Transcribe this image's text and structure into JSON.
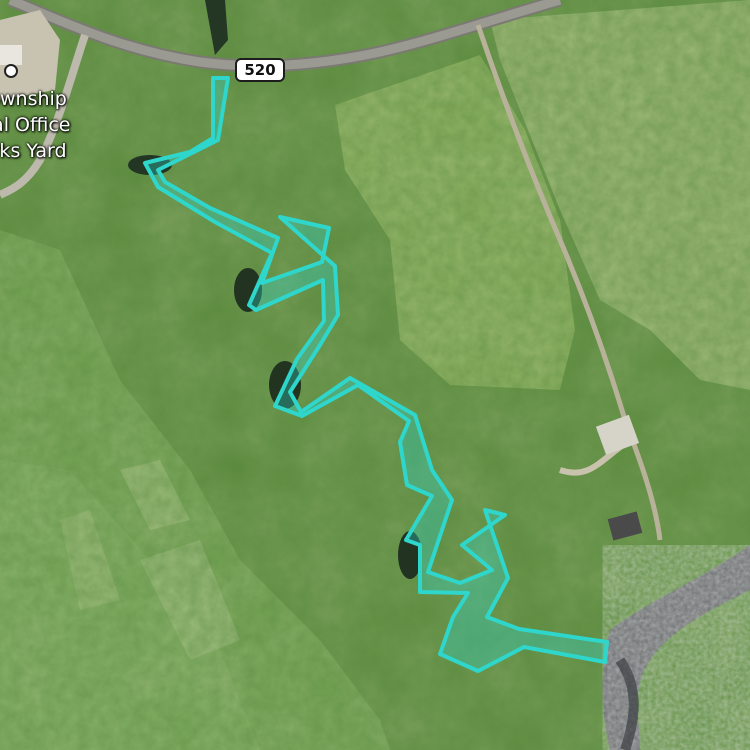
{
  "map": {
    "road_shield": "520",
    "poi_label_lines": [
      "Township",
      "pal Office",
      "orks Yard"
    ],
    "highlight_color": "#2fd6cc",
    "icons": [
      "poi-marker-icon",
      "highway-shield-icon"
    ]
  }
}
